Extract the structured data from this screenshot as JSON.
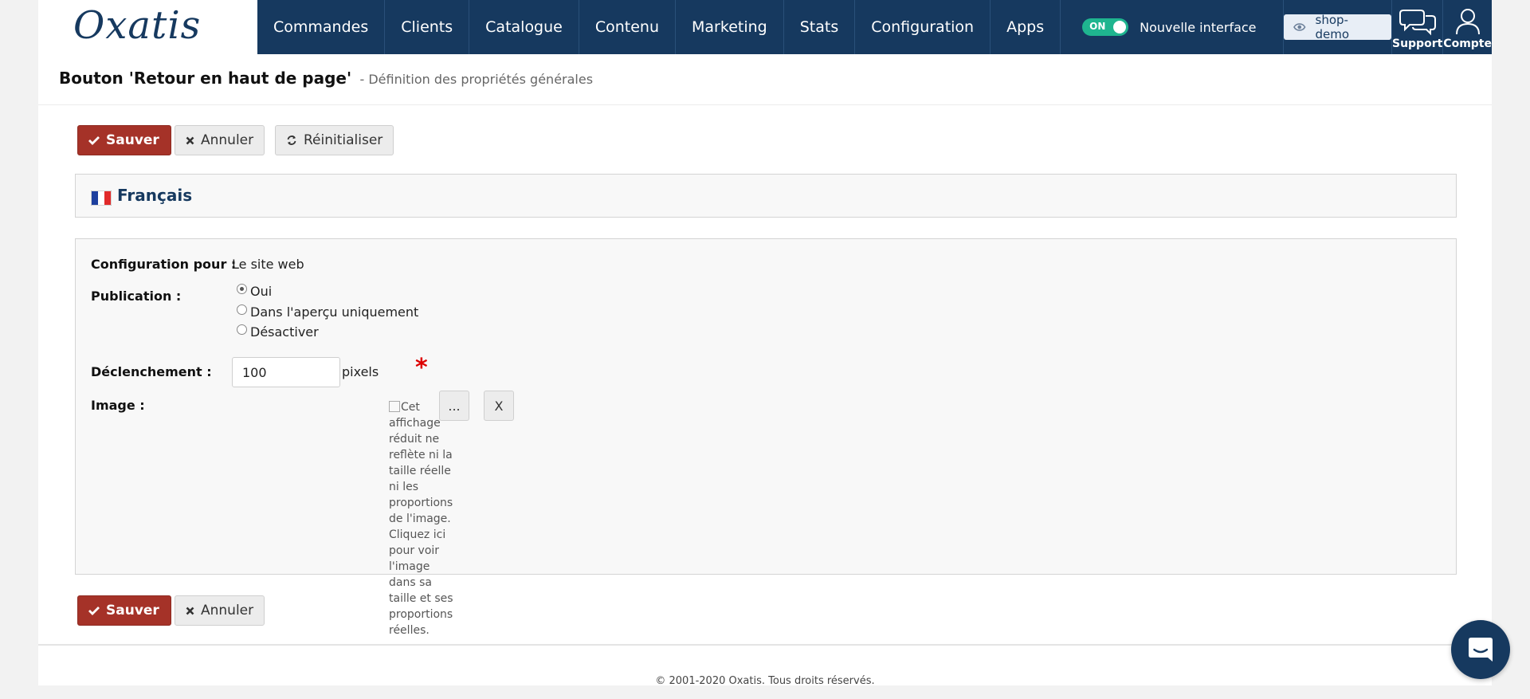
{
  "nav": {
    "items": [
      "Commandes",
      "Clients",
      "Catalogue",
      "Contenu",
      "Marketing",
      "Stats",
      "Configuration",
      "Apps"
    ],
    "toggle_label": "ON",
    "new_interface_label": "Nouvelle interface",
    "shop_label": "shop-demo",
    "support_label": "Support",
    "account_label": "Compte"
  },
  "page": {
    "title": "Bouton 'Retour en haut de page'",
    "subtitle": "- Définition des propriétés générales"
  },
  "actions": {
    "save_label": "Sauver",
    "cancel_label": "Annuler",
    "reset_label": "Réinitialiser"
  },
  "language": {
    "label": "Français"
  },
  "form": {
    "config_label": "Configuration pour :",
    "config_value": "Le site web",
    "publication_label": "Publication :",
    "publication_options": [
      "Oui",
      "Dans l'aperçu uniquement",
      "Désactiver"
    ],
    "publication_selected": "Oui",
    "trigger_label": "Déclenchement :",
    "trigger_value": "100",
    "trigger_unit": "pixels",
    "required_mark": "*",
    "image_label": "Image :",
    "image_browse_label": "...",
    "image_clear_label": "X",
    "image_alt_text": "Cet affichage réduit ne reflète ni la taille réelle ni les proportions de l'image. Cliquez ici pour voir l'image dans sa taille et ses proportions réelles."
  },
  "footer": {
    "copyright": "© 2001-2020 Oxatis. Tous droits réservés."
  },
  "colors": {
    "nav_bg": "#16395f",
    "save_bg": "#a53228",
    "toggle_on": "#1fb58f",
    "required": "#dd0000"
  }
}
